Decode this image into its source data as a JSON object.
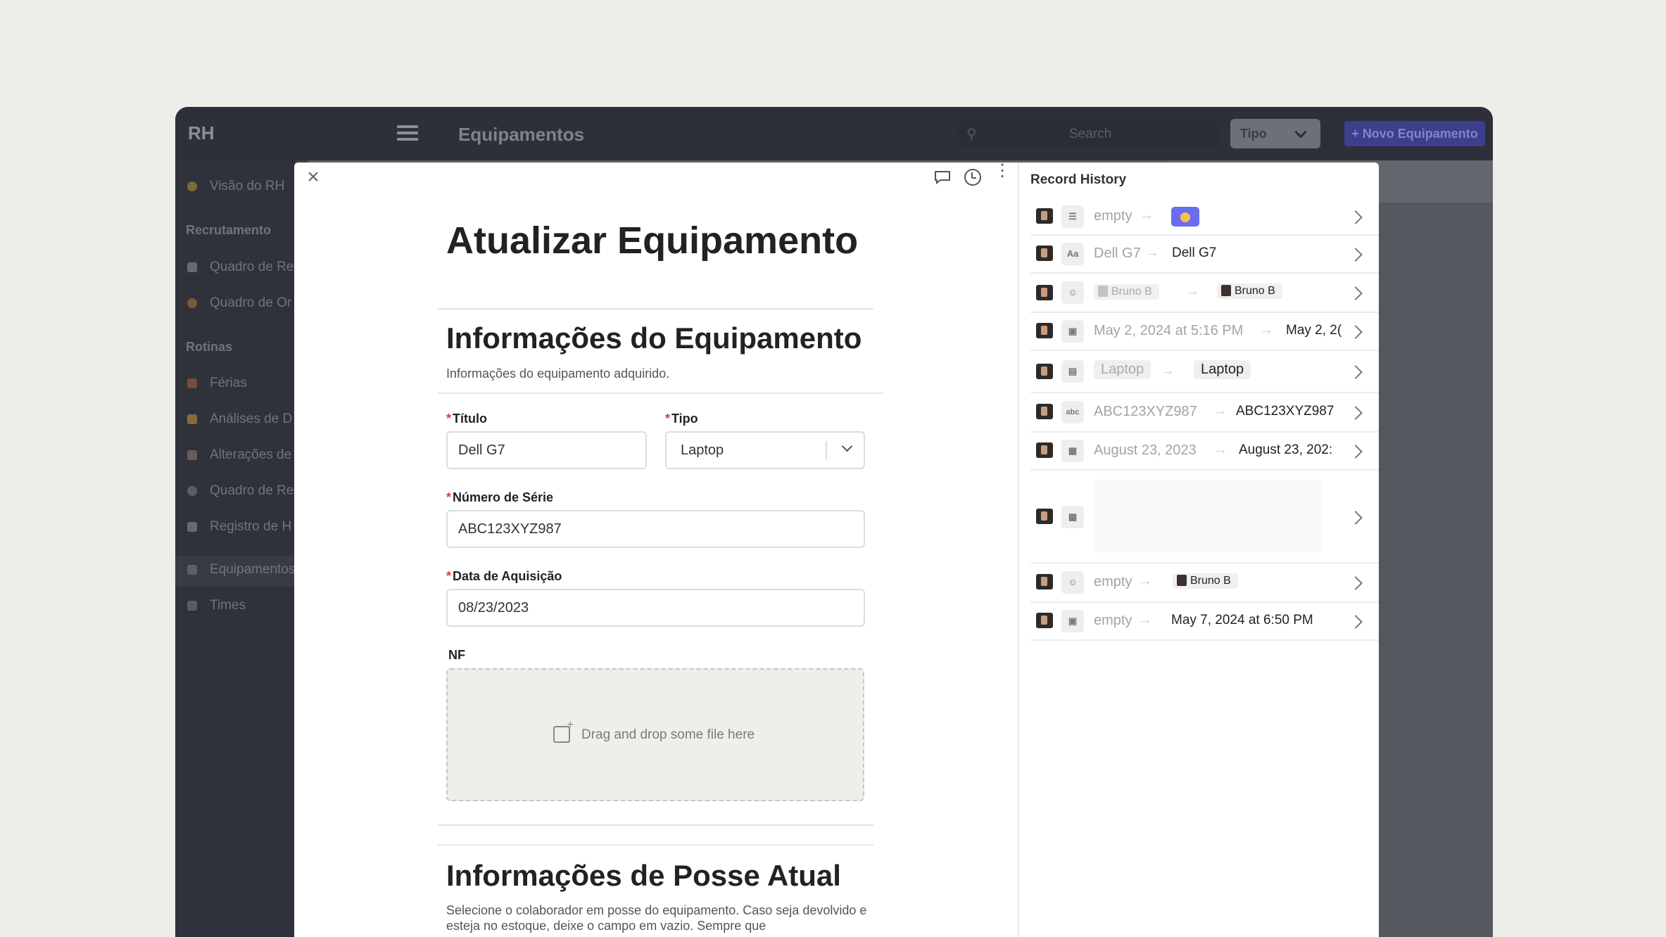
{
  "app": {
    "name": "RH",
    "page_title": "Equipamentos",
    "search_placeholder": "Search",
    "filter_label": "Tipo",
    "new_button": "+ Novo Equipamento"
  },
  "sidebar": {
    "items_top": [
      {
        "label": "Visão do RH",
        "icon": "person-icon"
      }
    ],
    "section_recrutamento": "Recrutamento",
    "items_recrutamento": [
      {
        "label": "Quadro de Re",
        "icon": "board-icon"
      },
      {
        "label": "Quadro de Or",
        "icon": "org-icon"
      }
    ],
    "section_rotinas": "Rotinas",
    "items_rotinas": [
      {
        "label": "Férias",
        "icon": "umbrella-icon"
      },
      {
        "label": "Análises de D",
        "icon": "muscle-icon"
      },
      {
        "label": "Alterações de",
        "icon": "rocket-icon"
      },
      {
        "label": "Quadro de Re",
        "icon": "globe-icon"
      },
      {
        "label": "Registro de H",
        "icon": "hourglass-icon"
      }
    ],
    "items_bottom": [
      {
        "label": "Equipamentos",
        "icon": "laptop-icon",
        "active": true
      },
      {
        "label": "Times",
        "icon": "team-icon"
      }
    ]
  },
  "form": {
    "title": "Atualizar Equipamento",
    "section1": {
      "title": "Informações do Equipamento",
      "subtitle": "Informações do equipamento adquirido."
    },
    "fields": {
      "titulo": {
        "label": "Título",
        "value": "Dell G7"
      },
      "tipo": {
        "label": "Tipo",
        "value": "Laptop"
      },
      "serie": {
        "label": "Número de Série",
        "value": "ABC123XYZ987"
      },
      "data": {
        "label": "Data de Aquisição",
        "value": "08/23/2023"
      },
      "nf": {
        "label": "NF",
        "drop_text": "Drag and drop some file here"
      }
    },
    "section2": {
      "title": "Informações de Posse Atual",
      "subtitle": "Selecione o colaborador em posse do equipamento. Caso seja devolvido e esteja no estoque, deixe o campo em vazio. Sempre que"
    }
  },
  "history": {
    "title": "Record History",
    "rows": [
      {
        "field_icon": "status-icon",
        "old": "empty",
        "new": ""
      },
      {
        "field_icon": "text-icon",
        "field_glyph": "Aa",
        "old": "Dell G7",
        "new": "Dell G7"
      },
      {
        "field_icon": "user-icon",
        "old": "Bruno B",
        "new": "Bruno B"
      },
      {
        "field_icon": "date-icon",
        "old": "May 2, 2024 at 5:16 PM",
        "new": "May 2, 2("
      },
      {
        "field_icon": "select-icon",
        "old": "Laptop",
        "new": "Laptop"
      },
      {
        "field_icon": "string-icon",
        "field_glyph": "abc",
        "old": "ABC123XYZ987",
        "new": "ABC123XYZ987"
      },
      {
        "field_icon": "calendar-icon",
        "old": "August 23, 2023",
        "new": "August 23, 202:"
      },
      {
        "field_icon": "file-icon",
        "old": "",
        "new": ""
      },
      {
        "field_icon": "user-icon",
        "old": "empty",
        "new": "Bruno B"
      },
      {
        "field_icon": "date-icon",
        "old": "empty",
        "new": "May 7, 2024 at 6:50 PM"
      }
    ]
  },
  "colors": {
    "accent": "#6b6cf0",
    "required": "#e03b3b",
    "background": "#ededea"
  }
}
